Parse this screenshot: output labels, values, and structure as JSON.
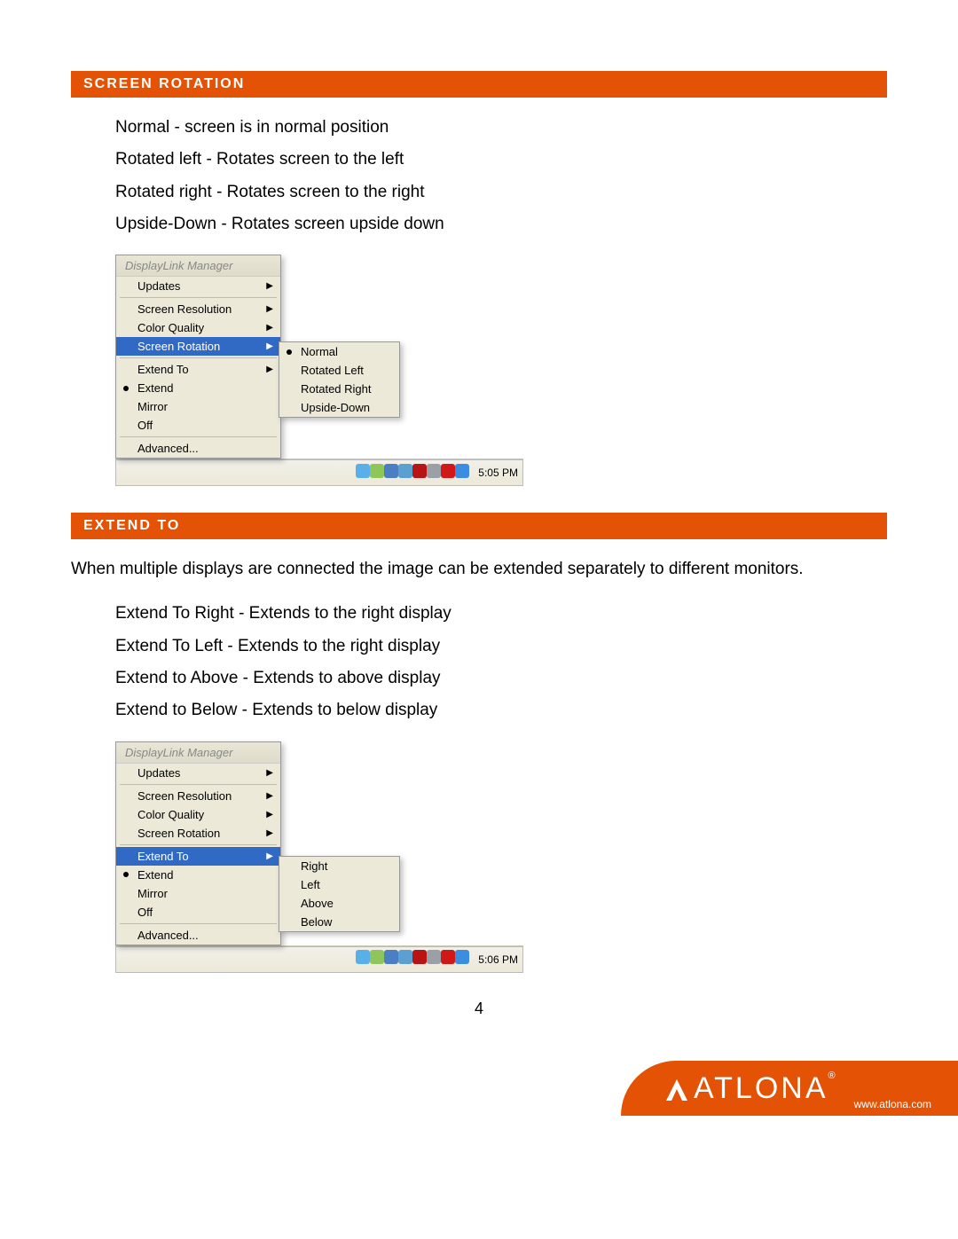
{
  "pageNumber": "4",
  "footer": {
    "brand": "Atlona",
    "url": "www.atlona.com"
  },
  "section1": {
    "title": "Screen Rotation",
    "lines": [
      "Normal - screen is in normal position",
      "Rotated left - Rotates screen to the left",
      "Rotated right - Rotates screen to the right",
      "Upside-Down - Rotates screen upside down"
    ],
    "menu": {
      "title": "DisplayLink Manager",
      "items": [
        {
          "label": "Updates",
          "arrow": true
        },
        {
          "sep": true
        },
        {
          "label": "Screen Resolution",
          "arrow": true
        },
        {
          "label": "Color Quality",
          "arrow": true
        },
        {
          "label": "Screen Rotation",
          "arrow": true,
          "selected": true
        },
        {
          "sep": true
        },
        {
          "label": "Extend To",
          "arrow": true
        },
        {
          "label": "Extend",
          "bullet": true
        },
        {
          "label": "Mirror"
        },
        {
          "label": "Off"
        },
        {
          "sep": true
        },
        {
          "label": "Advanced..."
        }
      ],
      "submenuTop": "97px",
      "submenu": [
        {
          "label": "Normal",
          "bullet": true
        },
        {
          "label": "Rotated Left"
        },
        {
          "label": "Rotated Right"
        },
        {
          "label": "Upside-Down"
        }
      ],
      "time": "5:05 PM"
    }
  },
  "section2": {
    "title": "Extend To",
    "intro": "When multiple displays are connected the image can be extended separately to different monitors.",
    "lines": [
      "Extend To Right - Extends to the right display",
      "Extend To Left - Extends to the right display",
      "Extend to Above - Extends to above display",
      "Extend to Below - Extends to below display"
    ],
    "menu": {
      "title": "DisplayLink Manager",
      "items": [
        {
          "label": "Updates",
          "arrow": true
        },
        {
          "sep": true
        },
        {
          "label": "Screen Resolution",
          "arrow": true
        },
        {
          "label": "Color Quality",
          "arrow": true
        },
        {
          "label": "Screen Rotation",
          "arrow": true
        },
        {
          "sep": true
        },
        {
          "label": "Extend To",
          "arrow": true,
          "selected": true
        },
        {
          "label": "Extend",
          "bullet": true
        },
        {
          "label": "Mirror"
        },
        {
          "label": "Off"
        },
        {
          "sep": true
        },
        {
          "label": "Advanced..."
        }
      ],
      "submenuTop": "128px",
      "submenu": [
        {
          "label": "Right"
        },
        {
          "label": "Left"
        },
        {
          "label": "Above"
        },
        {
          "label": "Below"
        }
      ],
      "time": "5:06 PM"
    }
  },
  "trayColors": [
    "#59b0e8",
    "#8fc65b",
    "#4b7fc4",
    "#5aa0d0",
    "#b81414",
    "#9aa0a6",
    "#d01818",
    "#3a8de0"
  ]
}
